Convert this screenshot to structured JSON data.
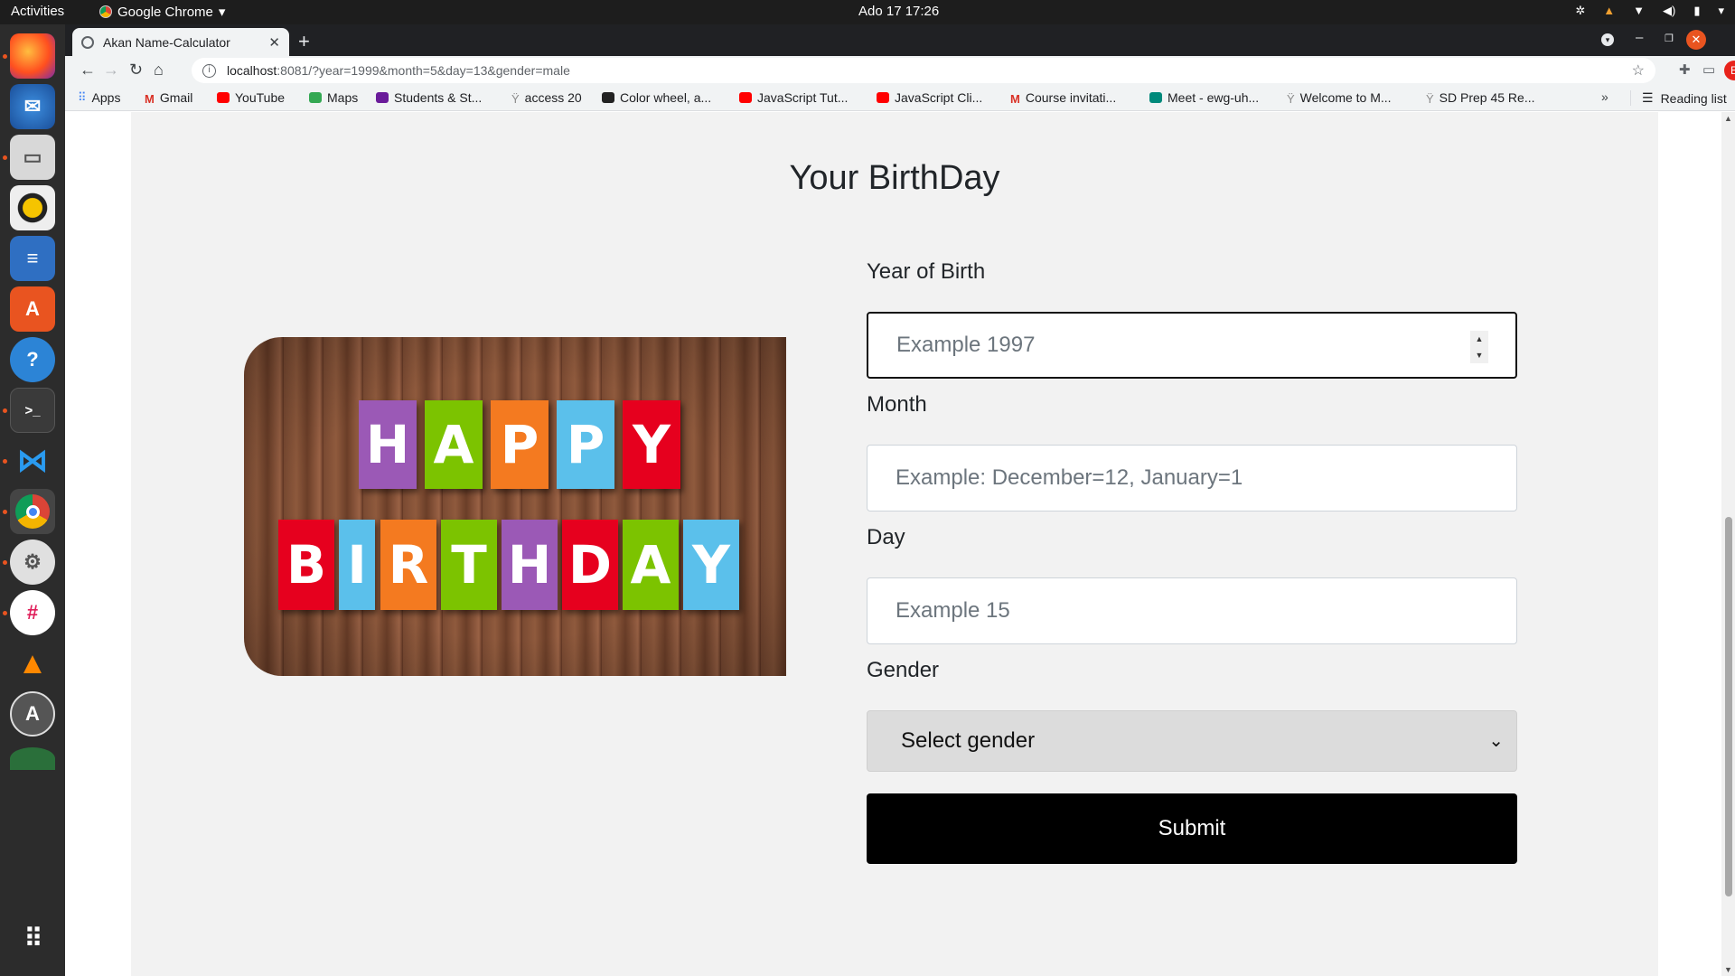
{
  "system": {
    "activities_label": "Activities",
    "app_name": "Google Chrome",
    "clock": "Ado 17  17:26"
  },
  "dock": {
    "apps": [
      "firefox-icon",
      "thunderbird-icon",
      "files-icon",
      "rhythmbox-icon",
      "writer-icon",
      "app-center-icon",
      "help-icon",
      "terminal-icon",
      "vscode-icon",
      "chrome-icon",
      "settings-icon",
      "slack-icon",
      "vlc-icon",
      "software-updater-icon",
      "show-apps-icon"
    ]
  },
  "browser": {
    "tab_title": "Akan Name-Calculator",
    "url_host": "localhost",
    "url_rest": ":8081/?year=1999&month=5&day=13&gender=male",
    "profile_initial": "E",
    "bookmarks": [
      {
        "label": "Apps",
        "icon": "apps-grid-icon"
      },
      {
        "label": "Gmail",
        "icon": "gmail-icon"
      },
      {
        "label": "YouTube",
        "icon": "youtube-icon"
      },
      {
        "label": "Maps",
        "icon": "maps-icon"
      },
      {
        "label": "Students & St...",
        "icon": "classroom-icon"
      },
      {
        "label": "access 20",
        "icon": "palm-icon"
      },
      {
        "label": "Color wheel, a...",
        "icon": "color-wheel-icon"
      },
      {
        "label": "JavaScript Tut...",
        "icon": "youtube-icon"
      },
      {
        "label": "JavaScript Cli...",
        "icon": "youtube-icon"
      },
      {
        "label": "Course invitati...",
        "icon": "gmail-icon"
      },
      {
        "label": "Meet - ewg-uh...",
        "icon": "meet-icon"
      },
      {
        "label": "Welcome to M...",
        "icon": "palm-icon"
      },
      {
        "label": "SD Prep 45 Re...",
        "icon": "palm-icon"
      }
    ],
    "reading_list": "Reading list"
  },
  "page": {
    "title": "Your BirthDay",
    "image": {
      "row1": [
        "H",
        "A",
        "P",
        "P",
        "Y"
      ],
      "row2": [
        "B",
        "I",
        "R",
        "T",
        "H",
        "D",
        "A",
        "Y"
      ],
      "colors": {
        "purple": "#9b59b6",
        "green": "#7cc300",
        "orange": "#f47a20",
        "blue": "#5bc0eb",
        "red": "#e6001e"
      }
    },
    "form": {
      "year_label": "Year of Birth",
      "year_placeholder": "Example 1997",
      "month_label": "Month",
      "month_placeholder": "Example: December=12, January=1",
      "day_label": "Day",
      "day_placeholder": "Example 15",
      "gender_label": "Gender",
      "gender_selected": "Select gender",
      "submit_label": "Submit"
    }
  }
}
